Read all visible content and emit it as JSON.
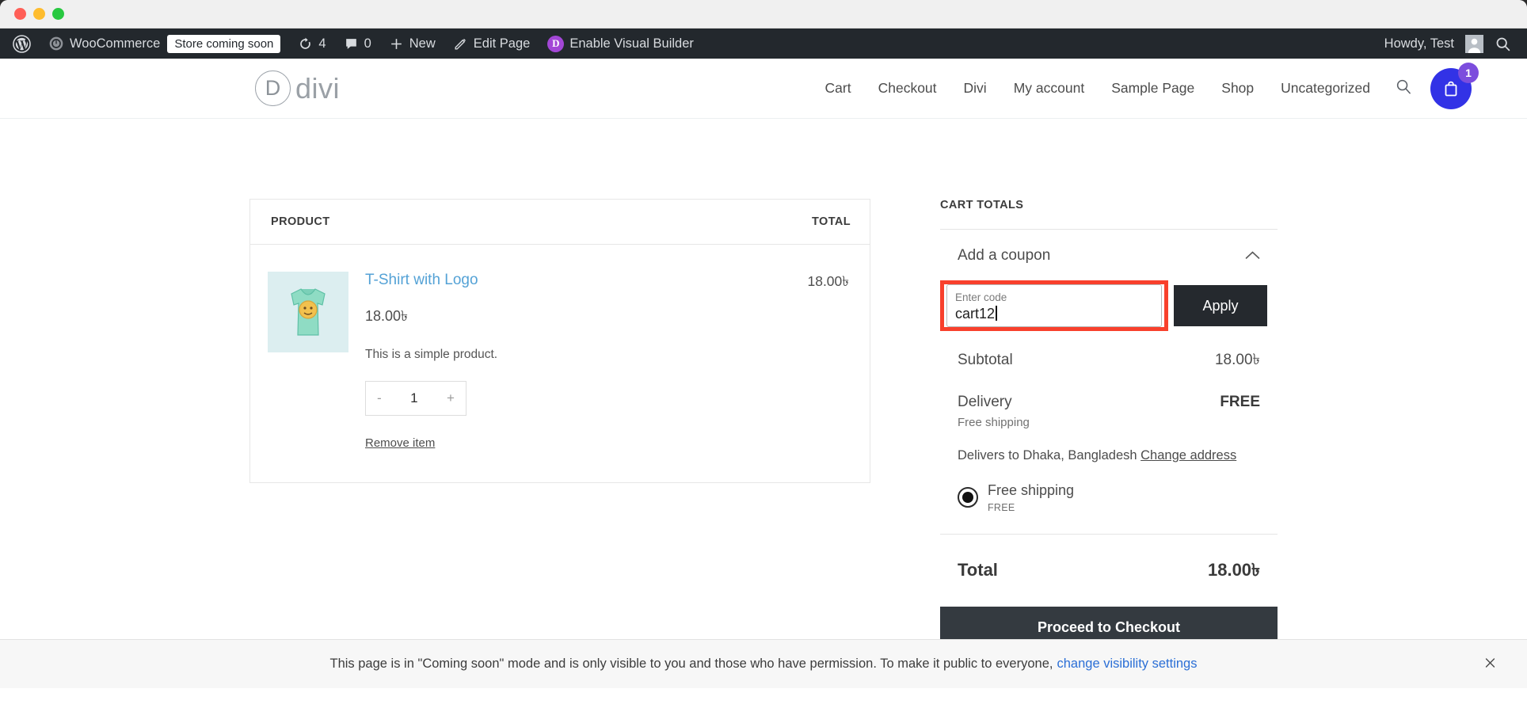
{
  "window": {
    "traffic_lights": [
      "close",
      "minimize",
      "maximize"
    ]
  },
  "admin_bar": {
    "wp_logo": "wordpress-logo-icon",
    "items": [
      {
        "label": "WooCommerce",
        "icon": "woocommerce-icon"
      },
      {
        "label": "Store coming soon",
        "type": "pill"
      },
      {
        "label": "4",
        "icon": "updates-icon"
      },
      {
        "label": "0",
        "icon": "comments-icon"
      },
      {
        "label": "New",
        "icon": "plus-icon"
      },
      {
        "label": "Edit Page",
        "icon": "pencil-icon"
      },
      {
        "label": "Enable Visual Builder",
        "icon": "divi-icon",
        "badge": "D"
      }
    ],
    "howdy": "Howdy, Test",
    "avatar": "user-avatar",
    "search": "search-icon"
  },
  "site_header": {
    "logo_letter": "D",
    "logo_text": "divi",
    "nav": [
      {
        "label": "Cart"
      },
      {
        "label": "Checkout"
      },
      {
        "label": "Divi"
      },
      {
        "label": "My account"
      },
      {
        "label": "Sample Page"
      },
      {
        "label": "Shop"
      },
      {
        "label": "Uncategorized"
      }
    ],
    "search_icon": "search-icon",
    "cart_icon": "shopping-bag-icon",
    "cart_count": "1",
    "cart_color": "#3232e6",
    "badge_color": "#7c4ddd"
  },
  "cart": {
    "columns": {
      "product": "PRODUCT",
      "total": "TOTAL"
    },
    "item": {
      "thumbnail": "t-shirt-product-thumbnail",
      "name": "T-Shirt with Logo",
      "price": "18.00৳",
      "description": "This is a simple product.",
      "quantity": "1",
      "minus": "-",
      "plus": "+",
      "remove_label": "Remove item",
      "line_total": "18.00৳"
    }
  },
  "cart_totals": {
    "title": "CART TOTALS",
    "coupon": {
      "header": "Add a coupon",
      "chevron": "chevron-up-icon",
      "placeholder": "Enter code",
      "value": "cart12",
      "apply_label": "Apply",
      "highlight_color": "#f8402c"
    },
    "subtotal": {
      "label": "Subtotal",
      "value": "18.00৳"
    },
    "delivery": {
      "label": "Delivery",
      "value": "FREE",
      "note": "Free shipping"
    },
    "delivers_to": "Delivers to Dhaka, Bangladesh",
    "change_address": "Change address",
    "shipping_option": {
      "label": "Free shipping",
      "sub": "FREE",
      "selected": true
    },
    "total": {
      "label": "Total",
      "value": "18.00৳"
    },
    "checkout_label": "Proceed to Checkout"
  },
  "notice": {
    "text": "This page is in \"Coming soon\" mode and is only visible to you and those who have permission. To make it public to everyone,",
    "link": "change visibility settings",
    "close": "close-icon"
  }
}
